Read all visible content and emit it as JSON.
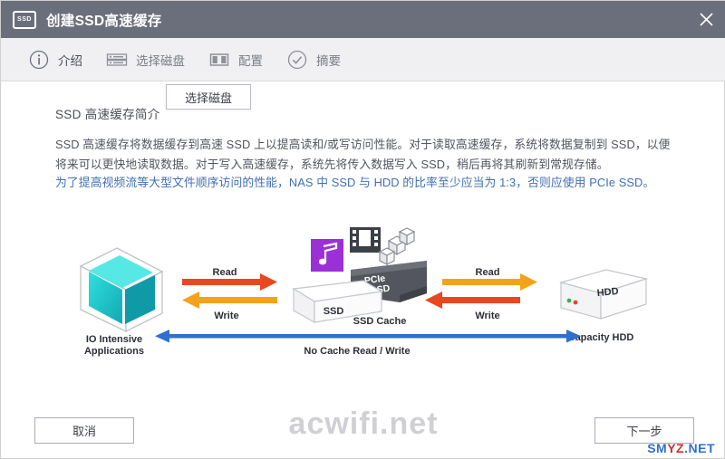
{
  "window": {
    "title": "创建SSD高速缓存",
    "icon": "ssd-icon",
    "close_icon": "close-icon"
  },
  "steps": [
    {
      "label": "介绍",
      "icon": "info-icon",
      "active": true
    },
    {
      "label": "选择磁盘",
      "icon": "disks-icon",
      "active": false
    },
    {
      "label": "配置",
      "icon": "config-icon",
      "active": false
    },
    {
      "label": "摘要",
      "icon": "check-icon",
      "active": false
    }
  ],
  "tooltip": {
    "text": "选择磁盘"
  },
  "content": {
    "section_title": "SSD 高速缓存简介",
    "paragraph1": "SSD 高速缓存将数据缓存到高速 SSD 上以提高读和/或写访问性能。对于读取高速缓存，系统将数据复制到 SSD，以便将来可以更快地读取数据。对于写入高速缓存，系统先将传入数据写入 SSD，稍后再将其刷新到常规存储。",
    "paragraph2": "为了提高视频流等大型文件顺序访问的性能，NAS 中 SSD 与 HDD 的比率至少应当为 1:3，否则应使用 PCIe SSD。"
  },
  "diagram": {
    "io_label_line1": "IO Intensive",
    "io_label_line2": "Applications",
    "ssd_cache_label": "SSD Cache",
    "capacity_hdd_label": "Capacity HDD",
    "ssd_block_text": "SSD",
    "pcie_ssd_text_line1": "PCIe",
    "pcie_ssd_text_line2": "SSD",
    "hdd_text": "HDD",
    "left_read": "Read",
    "left_write": "Write",
    "right_read": "Read",
    "right_write": "Write",
    "bottom_arrow_label": "No Cache Read / Write",
    "music_icon": "music-note-icon",
    "film_icon": "film-strip-icon",
    "cubes_icon": "cubes-icon",
    "colors": {
      "read_arrow": "#e8471f",
      "write_arrow": "#f4a21a",
      "no_cache_arrow": "#2f6fd0",
      "cube_teal": "#17c3c3",
      "music_purple": "#9b30d9"
    }
  },
  "watermark": {
    "main": "acwifi.net",
    "corner_black": "SM",
    "corner_red": "YZ",
    "corner_rest": ".NET"
  },
  "footer": {
    "cancel_label": "取消",
    "next_label": "下一步"
  }
}
